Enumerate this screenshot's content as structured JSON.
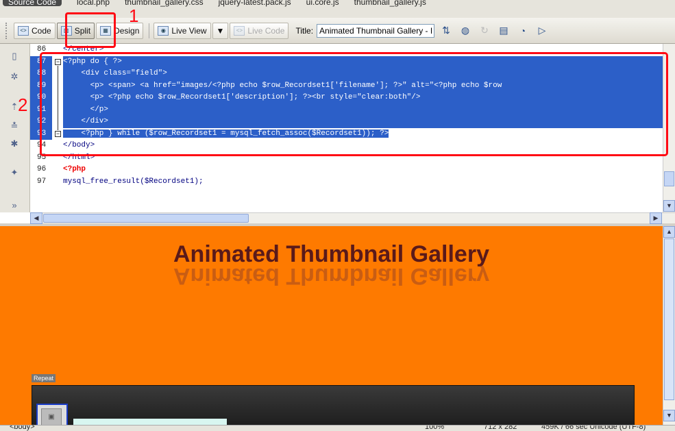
{
  "related_files": [
    "Source Code",
    "local.php",
    "thumbnail_gallery.css",
    "jquery-latest.pack.js",
    "ui.core.js",
    "thumbnail_gallery.js"
  ],
  "toolbar": {
    "code_label": "Code",
    "split_label": "Split",
    "design_label": "Design",
    "live_view_label": "Live View",
    "live_code_label": "Live Code",
    "title_label": "Title:",
    "title_value": "Animated Thumbnail Gallery - I"
  },
  "code": {
    "line_numbers": [
      "86",
      "87",
      "88",
      "89",
      "90",
      "91",
      "92",
      "93",
      "94",
      "95",
      "96",
      "97"
    ],
    "lines": [
      "</center>",
      "<?php do { ?>",
      "    <div class=\"field\">",
      "      <p> <span> <a href=\"images/<?php echo $row_Recordset1['filename']; ?>\" alt=\"<?php echo $row",
      "      <p> <?php echo $row_Recordset1['description']; ?><br style=\"clear:both\"/>",
      "      </p>",
      "    </div>",
      "    <?php } while ($row_Recordset1 = mysql_fetch_assoc($Recordset1)); ?>",
      "</body>",
      "</html>",
      "<?php",
      "mysql_free_result($Recordset1);"
    ]
  },
  "design": {
    "heading": "Animated Thumbnail Gallery",
    "repeat_label": "Repeat"
  },
  "status": {
    "left": "<body>",
    "zoom": "100%",
    "size": "712 x 282",
    "info": "459K / 66 sec  Unicode (UTF-8)"
  },
  "annotations": [
    "1",
    "2"
  ],
  "colors": {
    "selection": "#2c5fc8",
    "design_bg": "#fe7a00",
    "annotation": "#ff0a14"
  }
}
